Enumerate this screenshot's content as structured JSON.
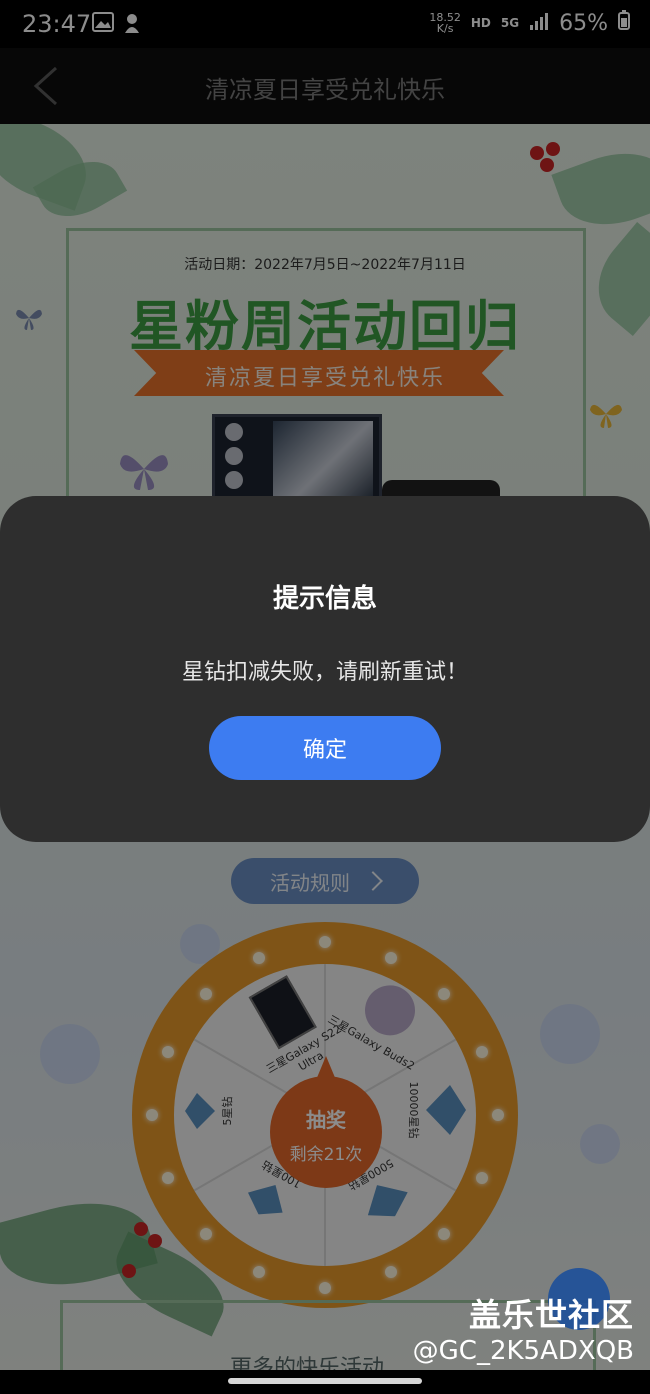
{
  "status_bar": {
    "time": "23:47",
    "net_speed_value": "18.52",
    "net_speed_unit": "K/s",
    "hd": "HD",
    "network": "5G",
    "battery": "65%"
  },
  "header": {
    "title": "清凉夏日享受兑礼快乐"
  },
  "banner": {
    "date": "活动日期：2022年7月5日~2022年7月11日",
    "title": "星粉周活动回归",
    "ribbon": "清凉夏日享受兑礼快乐"
  },
  "rules_button": {
    "label": "活动规则",
    "chevron": ">"
  },
  "wheel": {
    "center_title": "抽奖",
    "center_remaining": "剩余21次",
    "prizes": [
      "三星Galaxy S22 Ultra",
      "三星Galaxy Buds2",
      "10000星钻",
      "5000星钻",
      "100星钻",
      "5星钻"
    ]
  },
  "bottom": {
    "text": "更多的快乐活动"
  },
  "dialog": {
    "title": "提示信息",
    "message": "星钻扣减失败，请刷新重试！",
    "confirm": "确定"
  },
  "watermark": {
    "brand": "盖乐世社区",
    "user": "@GC_2K5ADXQB"
  },
  "colors": {
    "dialog_bg": "#2e2e2e",
    "confirm_button": "#3d7cf1",
    "banner_green": "#3d9d43",
    "ribbon_orange": "#e8722b",
    "wheel_orange": "#e89a2a"
  }
}
